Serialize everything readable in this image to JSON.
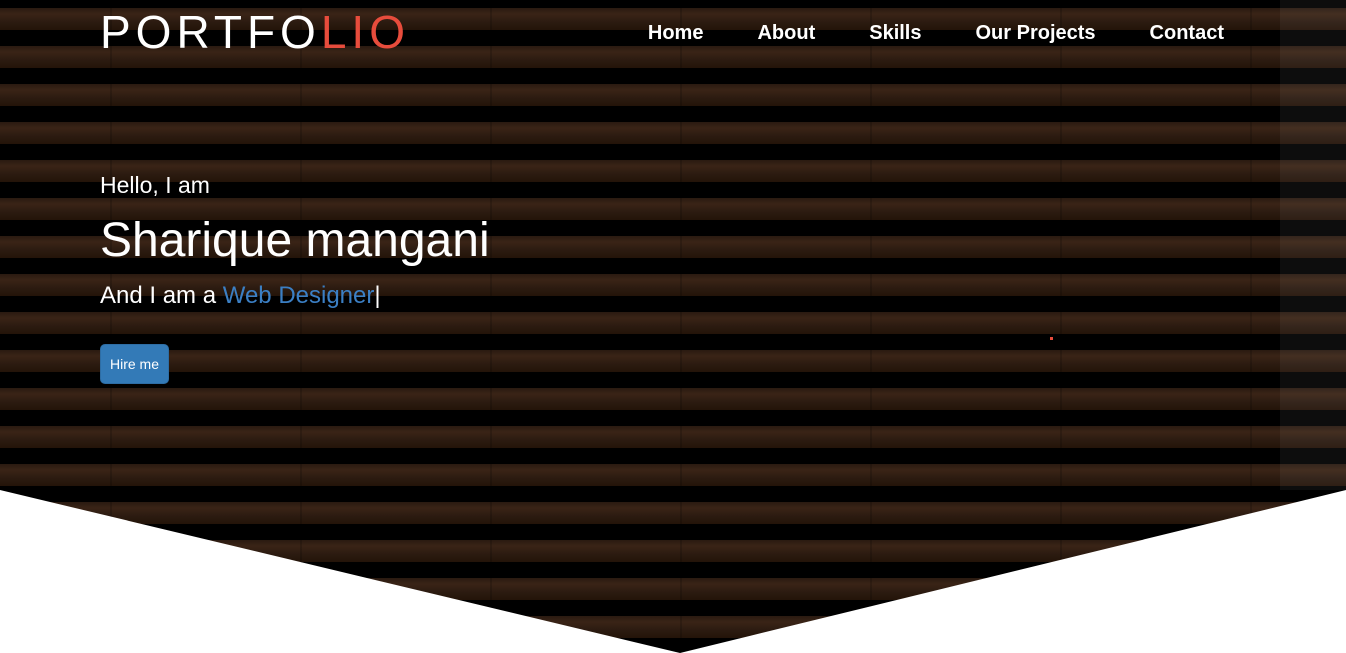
{
  "brand": {
    "logo_main": "PORTFO",
    "logo_accent": "LIO",
    "accent_color": "#e74c3c"
  },
  "nav": {
    "items": [
      {
        "label": "Home"
      },
      {
        "label": "About"
      },
      {
        "label": "Skills"
      },
      {
        "label": "Our Projects"
      },
      {
        "label": "Contact"
      }
    ]
  },
  "hero": {
    "greeting": "Hello, I am",
    "name": "Sharique mangani",
    "role_prefix": "And I am a ",
    "role_highlight": "Web Designer",
    "cursor": "|",
    "highlight_color": "#3b7fc4",
    "cta_label": "Hire me",
    "cta_color": "#337ab7"
  }
}
